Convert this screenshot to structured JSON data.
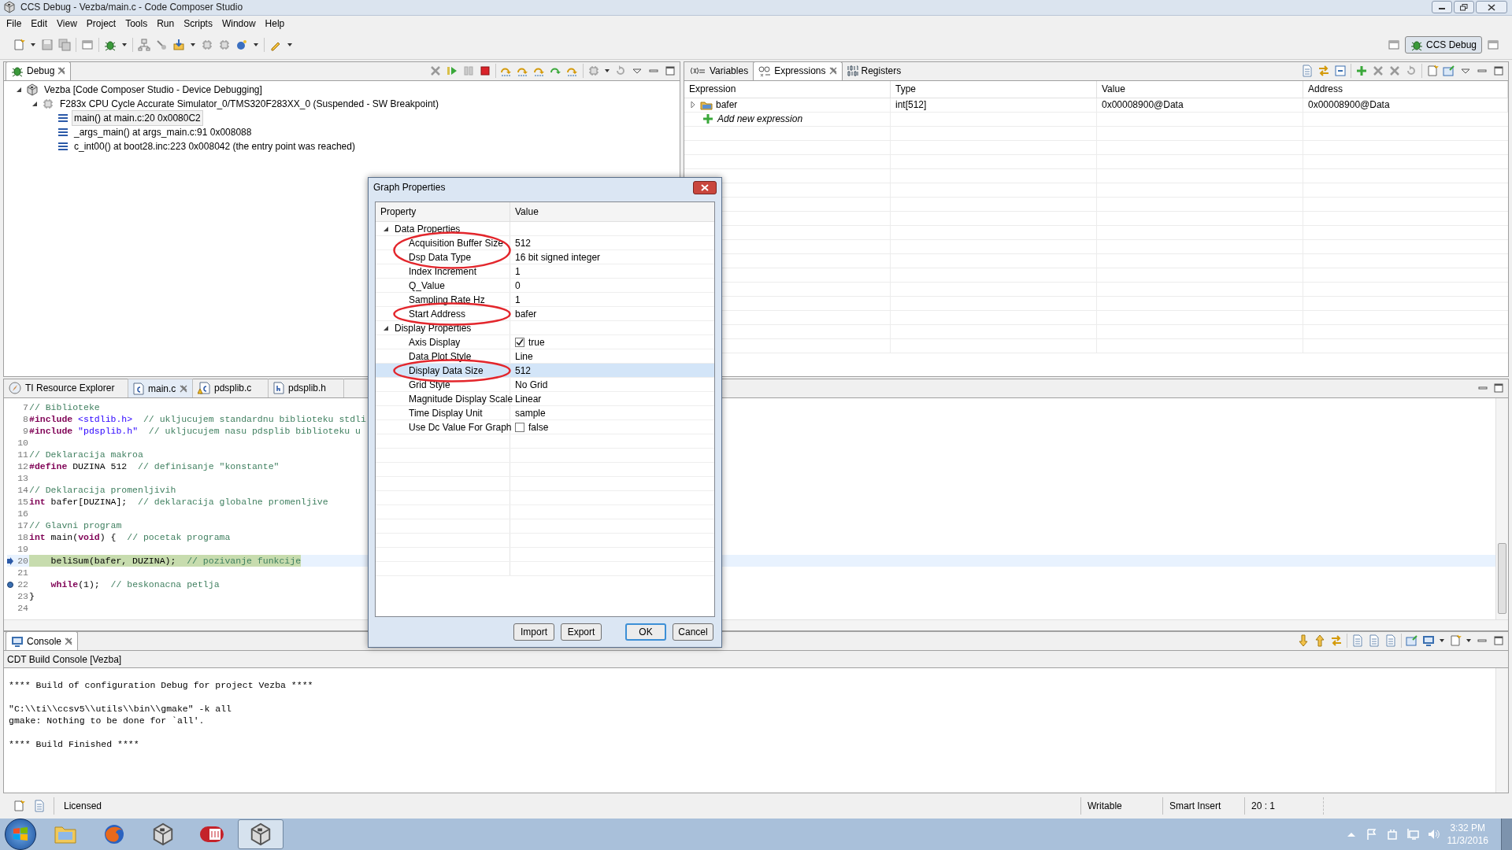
{
  "window": {
    "title": "CCS Debug - Vezba/main.c - Code Composer Studio"
  },
  "menu": [
    "File",
    "Edit",
    "View",
    "Project",
    "Tools",
    "Run",
    "Scripts",
    "Window",
    "Help"
  ],
  "perspective": {
    "label": "CCS Debug",
    "selected": true
  },
  "debug_view": {
    "tab": "Debug",
    "tree": [
      {
        "label": "Vezba [Code Composer Studio - Device Debugging]",
        "kind": "session",
        "expanded": true,
        "selected": false,
        "children": [
          {
            "label": "F283x CPU Cycle Accurate Simulator_0/TMS320F283XX_0 (Suspended - SW Breakpoint)",
            "kind": "target",
            "expanded": true,
            "selected": false,
            "children": [
              {
                "label": "main() at main.c:20 0x0080C2",
                "kind": "frame",
                "selected": true
              },
              {
                "label": "_args_main() at args_main.c:91 0x008088",
                "kind": "frame",
                "selected": false
              },
              {
                "label": "c_int00() at boot28.inc:223 0x008042  (the entry point was reached)",
                "kind": "frame",
                "selected": false
              }
            ]
          }
        ]
      }
    ]
  },
  "expressions_view": {
    "tabs": [
      {
        "label": "Variables",
        "kind": "variables",
        "selected": false
      },
      {
        "label": "Expressions",
        "kind": "expressions",
        "selected": true
      },
      {
        "label": "Registers",
        "kind": "registers",
        "selected": false
      }
    ],
    "columns": [
      "Expression",
      "Type",
      "Value",
      "Address"
    ],
    "rows": [
      {
        "expression": "bafer",
        "type": "int[512]",
        "value": "0x00008900@Data",
        "address": "0x00008900@Data",
        "expanded": false
      }
    ],
    "add_row": "Add new expression"
  },
  "editor": {
    "tabs": [
      {
        "label": "TI Resource Explorer",
        "kind": "explorer",
        "selected": false
      },
      {
        "label": "main.c",
        "kind": "c",
        "selected": true
      },
      {
        "label": "pdsplib.c",
        "kind": "c-warning",
        "selected": false
      },
      {
        "label": "pdsplib.h",
        "kind": "h",
        "selected": false
      }
    ],
    "lines": [
      {
        "number": "7",
        "current": false,
        "breakpoint": false,
        "tokens": [
          {
            "kind": "comment",
            "text": "// Biblioteke"
          }
        ]
      },
      {
        "number": "8",
        "current": false,
        "breakpoint": false,
        "tokens": [
          {
            "kind": "keyword",
            "text": "#include"
          },
          {
            "kind": "string",
            "text": " <stdlib.h>"
          },
          {
            "kind": "comment",
            "text": "  // ukljucujem standardnu biblioteku stdli"
          }
        ]
      },
      {
        "number": "9",
        "current": false,
        "breakpoint": false,
        "tokens": [
          {
            "kind": "keyword",
            "text": "#include"
          },
          {
            "kind": "string",
            "text": " \"pdsplib.h\""
          },
          {
            "kind": "comment",
            "text": "  // ukljucujem nasu pdsplib biblioteku u"
          }
        ]
      },
      {
        "number": "10",
        "current": false,
        "breakpoint": false
      },
      {
        "number": "11",
        "current": false,
        "breakpoint": false,
        "tokens": [
          {
            "kind": "comment",
            "text": "// Deklaracija makroa"
          }
        ]
      },
      {
        "number": "12",
        "current": false,
        "breakpoint": false,
        "tokens": [
          {
            "kind": "keyword",
            "text": "#define"
          },
          {
            "kind": "plain",
            "text": " DUZINA 512  "
          },
          {
            "kind": "comment",
            "text": "// definisanje \"konstante\""
          }
        ]
      },
      {
        "number": "13",
        "current": false,
        "breakpoint": false
      },
      {
        "number": "14",
        "current": false,
        "breakpoint": false,
        "tokens": [
          {
            "kind": "comment",
            "text": "// Deklaracija promenljivih"
          }
        ]
      },
      {
        "number": "15",
        "current": false,
        "breakpoint": false,
        "tokens": [
          {
            "kind": "keyword",
            "text": "int"
          },
          {
            "kind": "plain",
            "text": " bafer[DUZINA];  "
          },
          {
            "kind": "comment",
            "text": "// deklaracija globalne promenljive"
          }
        ]
      },
      {
        "number": "16",
        "current": false,
        "breakpoint": false
      },
      {
        "number": "17",
        "current": false,
        "breakpoint": false,
        "tokens": [
          {
            "kind": "comment",
            "text": "// Glavni program"
          }
        ]
      },
      {
        "number": "18",
        "current": false,
        "breakpoint": false,
        "tokens": [
          {
            "kind": "keyword",
            "text": "int"
          },
          {
            "kind": "plain",
            "text": " main("
          },
          {
            "kind": "keyword",
            "text": "void"
          },
          {
            "kind": "plain",
            "text": ") {  "
          },
          {
            "kind": "comment",
            "text": "// pocetak programa"
          }
        ]
      },
      {
        "number": "19",
        "current": false,
        "breakpoint": false
      },
      {
        "number": "20",
        "current": true,
        "breakpoint": false,
        "tokens": [
          {
            "kind": "plain",
            "text": "    beliSum(bafer, DUZINA);  "
          },
          {
            "kind": "comment",
            "text": "// pozivanje funkcije"
          }
        ]
      },
      {
        "number": "21",
        "current": false,
        "breakpoint": false
      },
      {
        "number": "22",
        "current": false,
        "breakpoint": true,
        "tokens": [
          {
            "kind": "keyword",
            "text": "    while"
          },
          {
            "kind": "plain",
            "text": "(1);  "
          },
          {
            "kind": "comment",
            "text": "// beskonacna petlja"
          }
        ]
      },
      {
        "number": "23",
        "current": false,
        "breakpoint": false,
        "tokens": [
          {
            "kind": "plain",
            "text": "}"
          }
        ]
      },
      {
        "number": "24",
        "current": false,
        "breakpoint": false
      }
    ]
  },
  "dialog": {
    "title": "Graph Properties",
    "columns": [
      "Property",
      "Value"
    ],
    "groups": [
      {
        "label": "Data Properties",
        "expanded": true,
        "rows": [
          {
            "property": "Acquisition Buffer Size",
            "value": "512",
            "kind": "text",
            "selected": false,
            "circled": true
          },
          {
            "property": "Dsp Data Type",
            "value": "16 bit signed integer",
            "kind": "text",
            "selected": false,
            "circled": true
          },
          {
            "property": "Index Increment",
            "value": "1",
            "kind": "text",
            "selected": false,
            "circled": false
          },
          {
            "property": "Q_Value",
            "value": "0",
            "kind": "text",
            "selected": false,
            "circled": false
          },
          {
            "property": "Sampling Rate Hz",
            "value": "1",
            "kind": "text",
            "selected": false,
            "circled": false
          },
          {
            "property": "Start Address",
            "value": "bafer",
            "kind": "text",
            "selected": false,
            "circled": true
          }
        ]
      },
      {
        "label": "Display Properties",
        "expanded": true,
        "rows": [
          {
            "property": "Axis Display",
            "value": "true",
            "kind": "checkbox",
            "checked": true,
            "selected": false,
            "circled": false
          },
          {
            "property": "Data Plot Style",
            "value": "Line",
            "kind": "text",
            "selected": false,
            "circled": false
          },
          {
            "property": "Display Data Size",
            "value": "512",
            "kind": "text",
            "selected": true,
            "circled": true
          },
          {
            "property": "Grid Style",
            "value": "No Grid",
            "kind": "text",
            "selected": false,
            "circled": false
          },
          {
            "property": "Magnitude Display Scale",
            "value": "Linear",
            "kind": "text",
            "selected": false,
            "circled": false
          },
          {
            "property": "Time Display Unit",
            "value": "sample",
            "kind": "text",
            "selected": false,
            "circled": false
          },
          {
            "property": "Use Dc Value For Graph",
            "value": "false",
            "kind": "checkbox",
            "checked": false,
            "selected": false,
            "circled": false
          }
        ]
      }
    ],
    "buttons": [
      {
        "label": "Import",
        "default": false
      },
      {
        "label": "Export",
        "default": false
      },
      {
        "label": "OK",
        "default": true
      },
      {
        "label": "Cancel",
        "default": false
      }
    ]
  },
  "console": {
    "tab": "Console",
    "title": "CDT Build Console [Vezba]",
    "blocks": [
      [
        "**** Build of configuration Debug for project Vezba ****"
      ],
      [
        "\"C:\\\\ti\\\\ccsv5\\\\utils\\\\bin\\\\gmake\" -k all",
        "gmake: Nothing to be done for `all'."
      ],
      [
        "**** Build Finished ****"
      ]
    ]
  },
  "status_bar": {
    "left": [
      "Licensed"
    ],
    "right": [
      "Writable",
      "Smart Insert",
      "20 : 1"
    ]
  },
  "taskbar": {
    "apps": [
      {
        "kind": "folder",
        "selected": false
      },
      {
        "kind": "browser",
        "selected": false
      },
      {
        "kind": "cube",
        "selected": false
      },
      {
        "kind": "chip",
        "selected": false
      },
      {
        "kind": "cube",
        "selected": true
      }
    ],
    "time": "3:32 PM",
    "date": "11/3/2016"
  }
}
